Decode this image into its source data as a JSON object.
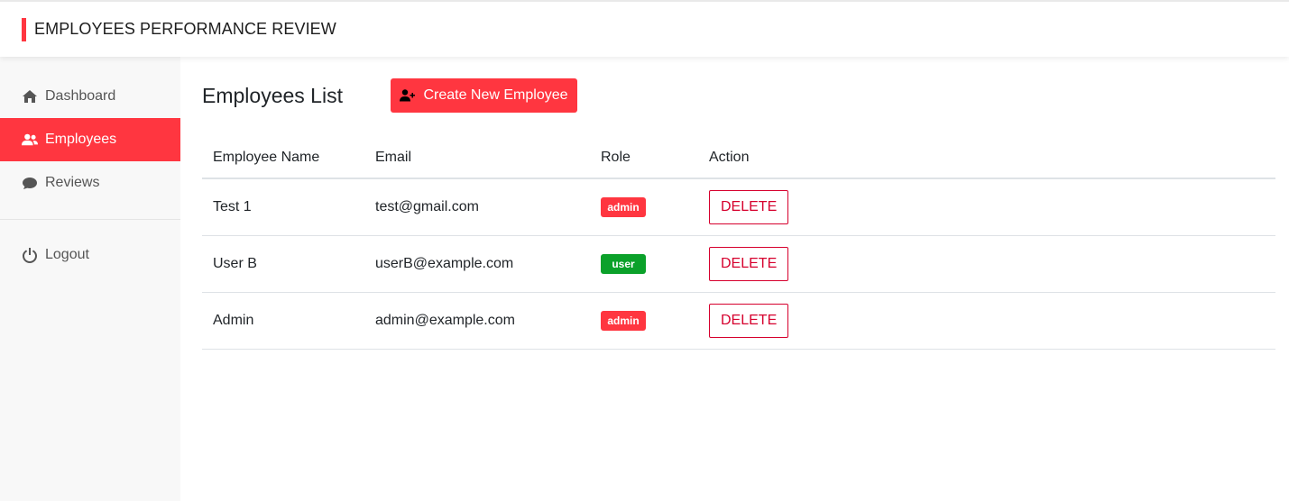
{
  "header": {
    "title": "EMPLOYEES PERFORMANCE REVIEW",
    "accent": "#ff3640"
  },
  "sidebar": {
    "items": [
      {
        "label": "Dashboard",
        "icon": "home-icon"
      },
      {
        "label": "Employees",
        "icon": "users-icon",
        "active": true
      },
      {
        "label": "Reviews",
        "icon": "comment-icon"
      },
      {
        "label": "Logout",
        "icon": "power-icon"
      }
    ]
  },
  "main": {
    "title": "Employees List",
    "create_button": "Create New Employee",
    "columns": [
      "Employee Name",
      "Email",
      "Role",
      "Action"
    ],
    "rows": [
      {
        "name": "Test 1",
        "email": "test@gmail.com",
        "role": "admin",
        "action": "DELETE"
      },
      {
        "name": "User B",
        "email": "userB@example.com",
        "role": "user",
        "action": "DELETE"
      },
      {
        "name": "Admin",
        "email": "admin@example.com",
        "role": "admin",
        "action": "DELETE"
      }
    ]
  },
  "colors": {
    "admin_badge": "#ff3640",
    "user_badge": "#0ba12a",
    "delete": "#d6002d"
  }
}
